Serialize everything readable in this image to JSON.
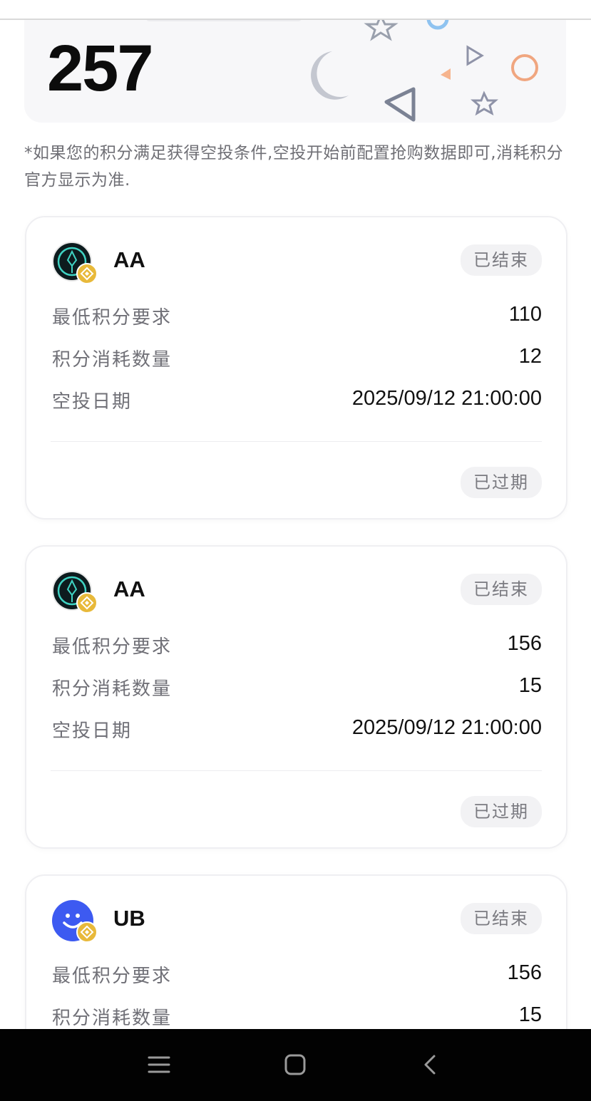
{
  "score": {
    "value": "257"
  },
  "note": "*如果您的积分满足获得空投条件,空投开始前配置抢购数据即可,消耗积分官方显示为准.",
  "cards": [
    {
      "coin": "AA",
      "status": "已结束",
      "rows": [
        {
          "label": "最低积分要求",
          "value": "110"
        },
        {
          "label": "积分消耗数量",
          "value": "12"
        },
        {
          "label": "空投日期",
          "value": "2025/09/12 21:00:00"
        }
      ],
      "footer_status": "已过期"
    },
    {
      "coin": "AA",
      "status": "已结束",
      "rows": [
        {
          "label": "最低积分要求",
          "value": "156"
        },
        {
          "label": "积分消耗数量",
          "value": "15"
        },
        {
          "label": "空投日期",
          "value": "2025/09/12 21:00:00"
        }
      ],
      "footer_status": "已过期"
    },
    {
      "coin": "UB",
      "status": "已结束",
      "rows": [
        {
          "label": "最低积分要求",
          "value": "156"
        },
        {
          "label": "积分消耗数量",
          "value": "15"
        }
      ]
    }
  ],
  "icons": {
    "aa_avatar": "aa-token-icon",
    "ub_avatar": "ub-token-icon",
    "chain_badge": "bnb-chain-icon",
    "nav_menu": "menu-icon",
    "nav_home": "home-icon",
    "nav_back": "back-icon"
  },
  "colors": {
    "accent_gold": "#e8b93a",
    "ub_blue": "#3d5af1",
    "aa_dark": "#0d1b1e",
    "aa_teal": "#3fd3c3"
  }
}
